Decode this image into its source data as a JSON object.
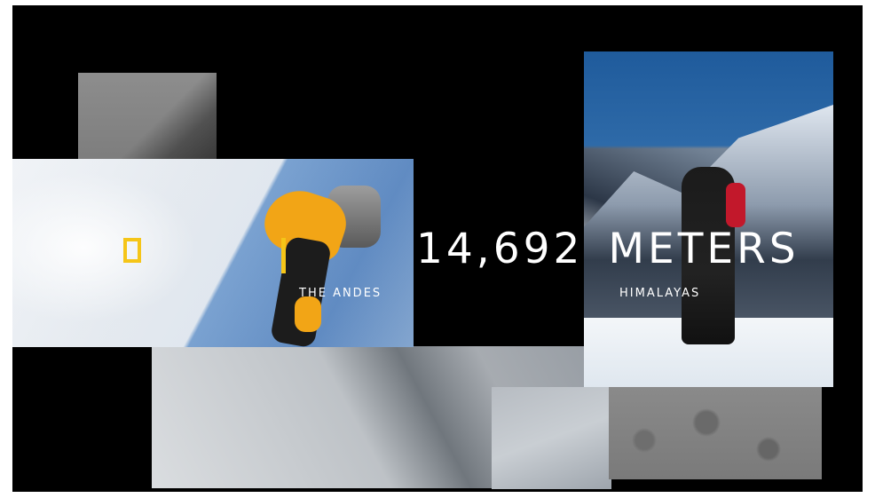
{
  "headline": {
    "number": "14,692",
    "unit": "METERS"
  },
  "labels": {
    "left": "THE ANDES",
    "right": "HIMALAYAS"
  },
  "brand": {
    "logo": "national-geographic-yellow-frame",
    "accent_color": "#f5c518"
  },
  "photos": [
    "rock-face",
    "andes-climber",
    "ice-slope",
    "snow-trail",
    "snow-footprints",
    "himalaya-hiker"
  ]
}
